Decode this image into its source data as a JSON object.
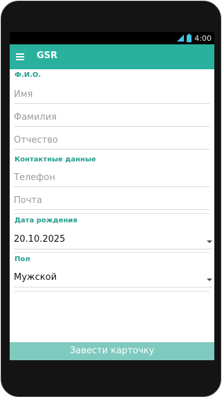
{
  "status_bar": {
    "time": "4:00",
    "icons": [
      "signal-icon",
      "battery-icon"
    ]
  },
  "app_bar": {
    "title": "GSR",
    "menu_icon": "menu-icon"
  },
  "form": {
    "fio_section": {
      "label": "Ф.И.О.",
      "first_name_placeholder": "Имя",
      "last_name_placeholder": "Фамилия",
      "patronymic_placeholder": "Отчество"
    },
    "contacts_section": {
      "label": "Контактные данные",
      "phone_placeholder": "Телефон",
      "email_placeholder": "Почта"
    },
    "birthdate_section": {
      "label": "Дата рождения",
      "value": "20.10.2025"
    },
    "gender_section": {
      "label": "Пол",
      "value": "Мужской"
    }
  },
  "submit_button": {
    "label": "Завести карточку"
  },
  "colors": {
    "accent": "#2ab19e",
    "section_label": "#219e8c",
    "button": "#7fcabe"
  }
}
